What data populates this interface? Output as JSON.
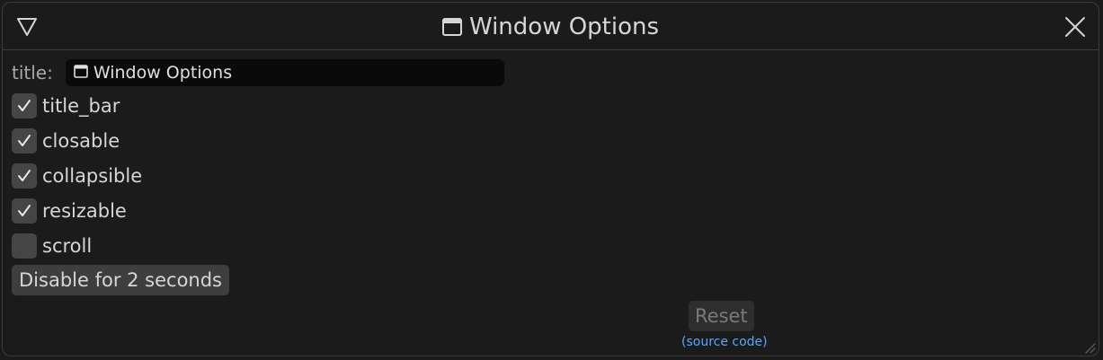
{
  "window": {
    "title": "Window Options",
    "icons": {
      "collapse": "triangle-down-icon",
      "title": "window-icon",
      "close": "close-icon"
    }
  },
  "form": {
    "title_label": "title:",
    "title_value": "Window Options",
    "checkboxes": [
      {
        "label": "title_bar",
        "checked": true
      },
      {
        "label": "closable",
        "checked": true
      },
      {
        "label": "collapsible",
        "checked": true
      },
      {
        "label": "resizable",
        "checked": true
      },
      {
        "label": "scroll",
        "checked": false
      }
    ],
    "disable_button": "Disable for 2 seconds",
    "reset_button": "Reset",
    "source_link": "(source code)"
  },
  "colors": {
    "background": "#1b1b1b",
    "text": "#d6d6d6",
    "link": "#5aa7ff",
    "checkbox": "#454545"
  }
}
